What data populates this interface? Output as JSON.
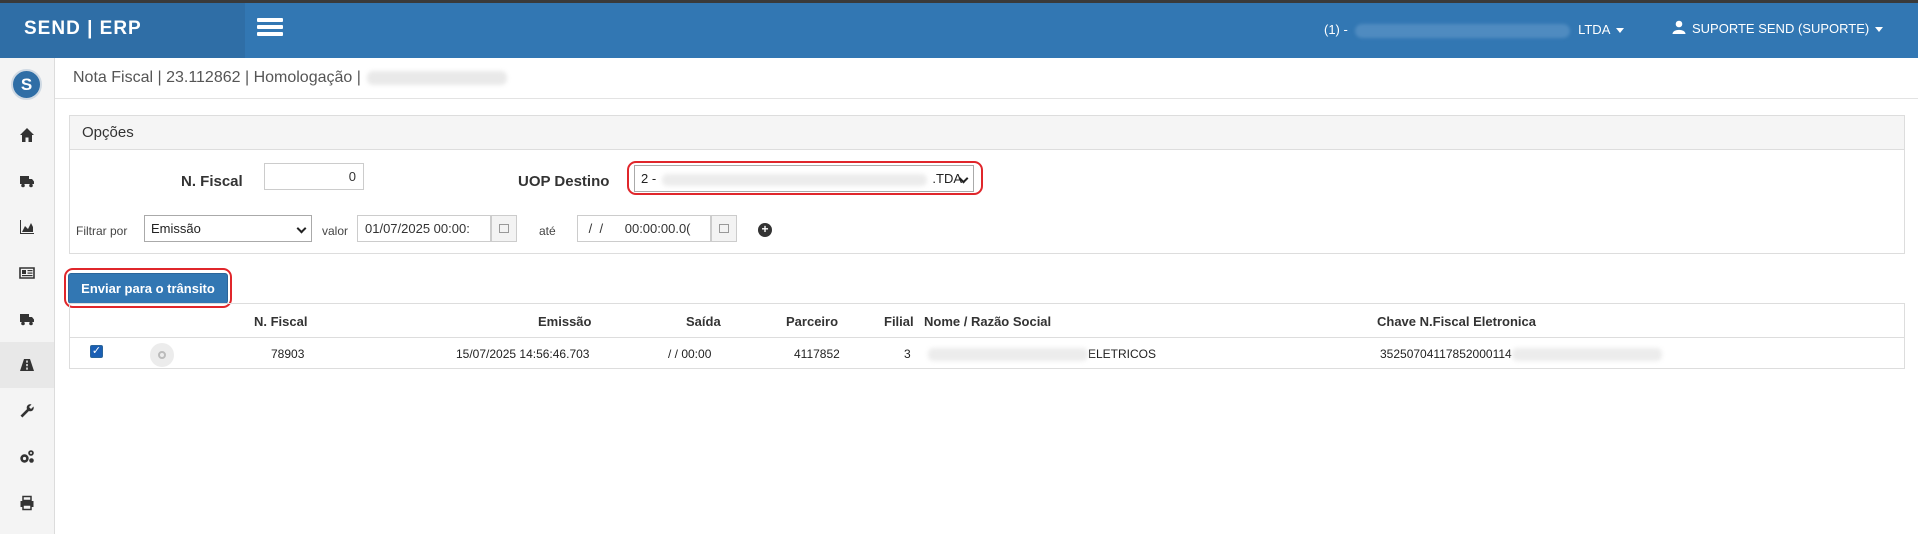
{
  "header": {
    "brand": "SEND | ERP",
    "company_prefix": "(1) -",
    "company_suffix": "LTDA",
    "user": "SUPORTE SEND (SUPORTE)"
  },
  "logo_text": "S",
  "sidebar": {
    "items": [
      {
        "icon": "home-icon"
      },
      {
        "icon": "truck-icon"
      },
      {
        "icon": "area-chart-icon"
      },
      {
        "icon": "newspaper-icon"
      },
      {
        "icon": "truck-icon"
      },
      {
        "icon": "road-icon",
        "active": true
      },
      {
        "icon": "wrench-icon"
      },
      {
        "icon": "cogs-icon"
      },
      {
        "icon": "print-icon"
      }
    ]
  },
  "breadcrumb": "Nota Fiscal | 23.112862 | Homologação |",
  "options": {
    "title": "Opções",
    "nfiscal_label": "N. Fiscal",
    "nfiscal_value": "0",
    "uop_label": "UOP Destino",
    "uop_value_prefix": "2 -",
    "uop_value_suffix": ".TDA",
    "filtrar_label": "Filtrar por",
    "filtrar_value": "Emissão",
    "valor_label": "valor",
    "valor_value": "01/07/2025 00:00:",
    "ate_label": "até",
    "ate_value": " /  /      00:00:00.0(",
    "add_symbol": "+"
  },
  "send_button": "Enviar para o trânsito",
  "table": {
    "headers": [
      "N. Fiscal",
      "Emissão",
      "Saída",
      "Parceiro",
      "Filial",
      "Nome / Razão Social",
      "Chave N.Fiscal Eletronica"
    ],
    "rows": [
      {
        "checked": true,
        "nfiscal": "78903",
        "emissao": "15/07/2025 14:56:46.703",
        "saida": "/ / 00:00",
        "parceiro": "4117852",
        "filial": "3",
        "nome_suffix": "ELETRICOS",
        "chave_prefix": "35250704117852000114"
      }
    ]
  }
}
